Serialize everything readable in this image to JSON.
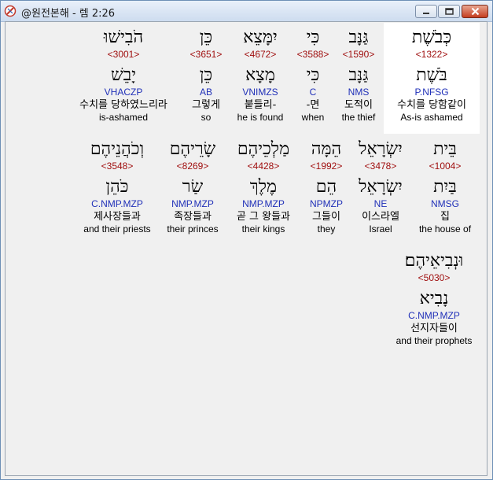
{
  "window": {
    "title": "@원전본해 - 렘 2:26"
  },
  "words": [
    {
      "hebrew": "כְּבֹשֶׁת",
      "strong": "<1322>",
      "lemma": "בֹּשֶׁת",
      "morph": "P.NFSG",
      "korean": "수치를 당함같이",
      "english": "As-is ashamed"
    },
    {
      "hebrew": "גַּנָּב",
      "strong": "<1590>",
      "lemma": "גַּנָּב",
      "morph": "NMS",
      "korean": "도적이",
      "english": "the thief"
    },
    {
      "hebrew": "כִּי",
      "strong": "<3588>",
      "lemma": "כִּי",
      "morph": "C",
      "korean": "-면",
      "english": "when"
    },
    {
      "hebrew": "יִמָּצֵא",
      "strong": "<4672>",
      "lemma": "מָצָא",
      "morph": "VNIMZS",
      "korean": "붙들리-",
      "english": "he is found"
    },
    {
      "hebrew": "כֵּן",
      "strong": "<3651>",
      "lemma": "כֵּן",
      "morph": "AB",
      "korean": "그렇게",
      "english": "so"
    },
    {
      "hebrew": "הֹבִישׁוּ",
      "strong": "<3001>",
      "lemma": "יָבֵשׁ",
      "morph": "VHACZP",
      "korean": "수치를 당하였느리라",
      "english": "is-ashamed"
    },
    {
      "hebrew": "בֵּית",
      "strong": "<1004>",
      "lemma": "בַּיִת",
      "morph": "NMSG",
      "korean": "집",
      "english": "the house of"
    },
    {
      "hebrew": "יִשְׂרָאֵל",
      "strong": "<3478>",
      "lemma": "יִשְׂרָאֵל",
      "morph": "NE",
      "korean": "이스라엘",
      "english": "Israel"
    },
    {
      "hebrew": "הֵמָּה",
      "strong": "<1992>",
      "lemma": "הֵם",
      "morph": "NPMZP",
      "korean": "그들이",
      "english": "they"
    },
    {
      "hebrew": "מַלְכֵיהֶם",
      "strong": "<4428>",
      "lemma": "מֶלֶךְ",
      "morph": "NMP.MZP",
      "korean": "곧 그 왕들과",
      "english": "their kings"
    },
    {
      "hebrew": "שָׂרֵיהֶם",
      "strong": "<8269>",
      "lemma": "שַׂר",
      "morph": "NMP.MZP",
      "korean": "족장들과",
      "english": "their princes"
    },
    {
      "hebrew": "וְכֹהֲנֵיהֶם",
      "strong": "<3548>",
      "lemma": "כֹּהֵן",
      "morph": "C.NMP.MZP",
      "korean": "제사장들과",
      "english": "and their priests"
    },
    {
      "hebrew": "וּנְבִיאֵיהֶם׃",
      "strong": "<5030>",
      "lemma": "נָבִיא",
      "morph": "C.NMP.MZP",
      "korean": "선지자들이",
      "english": "and their prophets"
    }
  ]
}
